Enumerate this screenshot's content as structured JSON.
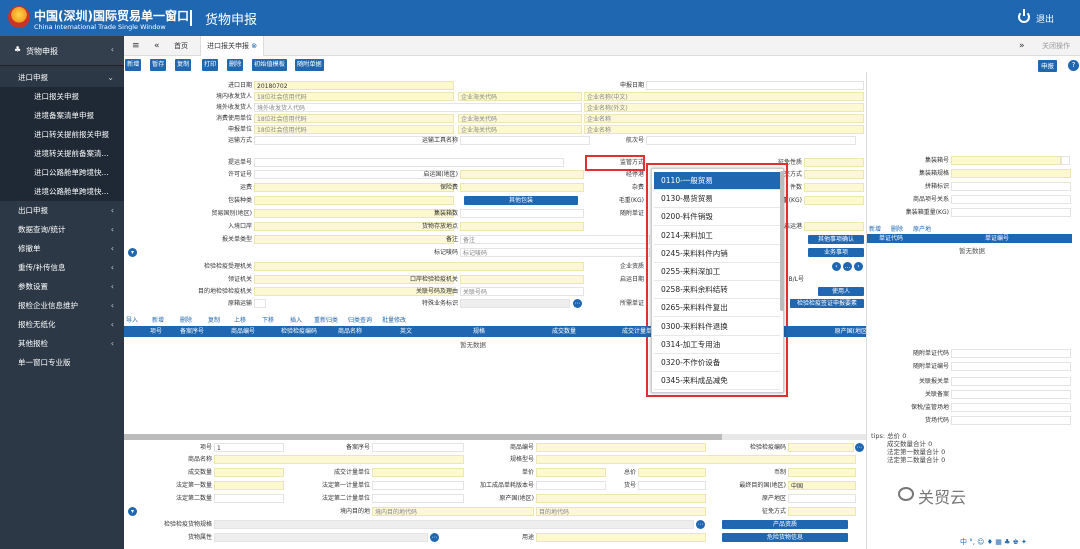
{
  "header": {
    "brand_cn": "中国(深圳)国际贸易单一窗口",
    "brand_en": "China International Trade Single Window",
    "page_title": "货物申报",
    "logout": "退出"
  },
  "sidebar": {
    "head": "货物申报",
    "items": [
      {
        "label": "进口申报",
        "sub": false
      },
      {
        "label": "进口报关申报",
        "sub": true
      },
      {
        "label": "进境备案清单申报",
        "sub": true
      },
      {
        "label": "进口转关提前报关申报",
        "sub": true
      },
      {
        "label": "进境转关提前备案清...",
        "sub": true
      },
      {
        "label": "进口公路舱单跨境快...",
        "sub": true
      },
      {
        "label": "进境公路舱单跨境快...",
        "sub": true
      },
      {
        "label": "出口申报",
        "sub": false
      },
      {
        "label": "数据查询/统计",
        "sub": false
      },
      {
        "label": "修撤单",
        "sub": false
      },
      {
        "label": "重传/补传信息",
        "sub": false
      },
      {
        "label": "参数设置",
        "sub": false
      },
      {
        "label": "报检企业信息维护",
        "sub": false
      },
      {
        "label": "报检无纸化",
        "sub": false
      },
      {
        "label": "其他报检",
        "sub": false
      },
      {
        "label": "单一窗口专业版",
        "sub": false
      }
    ]
  },
  "tabs": {
    "home": "首页",
    "active": "进口报关申报",
    "close_ops": "关闭操作"
  },
  "toolbar": [
    "新增",
    "暂存",
    "复制",
    "打印",
    "删除",
    "初始值模板",
    "随附单据"
  ],
  "declare_button": "申报",
  "form": {
    "import_date": "20180702",
    "import_date_label": "进口日期",
    "declare_date_label": "申报日期",
    "consignee_label": "境内收发货人",
    "consignee_ph": "18位社会信用代码",
    "company_code_ph": "企业海关代码",
    "company_name_ph": "企业名称(中文)",
    "overseas_label": "境外收发货人",
    "overseas_ph": "境外收发货人代码",
    "company_name_en_ph": "企业名称(外文)",
    "consumer_label": "消费使用单位",
    "declarant_label": "申报单位",
    "company_name_ph2": "企业名称",
    "transport_label": "运输方式",
    "vehicle_label": "运输工具名称",
    "voyage_label": "航次号",
    "bill_label": "提运单号",
    "supervision_label": "监管方式",
    "nature_label": "征免性质",
    "license_label": "许可证号",
    "origin_country_label": "启运国(地区)",
    "port_label": "经停港",
    "trade_terms_label": "成交方式",
    "freight_label": "运费",
    "insurance_label": "保险费",
    "misc_label": "杂费",
    "pieces_label": "件数",
    "packaging_label": "包装种类",
    "other_packaging": "其他包装",
    "gross_label": "毛重(KG)",
    "net_label": "净重(KG)",
    "trade_country_label": "贸易国别(地区)",
    "container_count_label": "集装箱数",
    "attached_label": "随附单证",
    "entry_port_label": "入境口岸",
    "goods_place_label": "货物存放地点",
    "dest_port_label": "启运港",
    "declare_type_label": "报关单类型",
    "remarks_label": "备注",
    "remarks_ph": "备注",
    "mark_label": "标记唛码",
    "mark_ph": "标记唛码",
    "other_matters": "其他事项确认",
    "business_matters": "业务事项",
    "inspection_auth_label": "检验检疫受理机关",
    "enterprise_qual_label": "企业资质",
    "receiving_auth_label": "领证机关",
    "port_auth_label": "口岸检验检疫机关",
    "arrival_date_label": "启运日期",
    "bl_label": "B/L号",
    "dest_auth_label": "目的地检验检疫机关",
    "related_no_label": "关联号码及理由",
    "related_no_ph": "关联号码",
    "user": "使用人",
    "original_label": "原箱运输",
    "special_label": "特殊业务标识",
    "required_label": "所需单证",
    "inspection_cert": "检验检疫签证申报要素"
  },
  "grid": {
    "toolbar": [
      "导入",
      "新增",
      "删除",
      "复制",
      "上移",
      "下移",
      "插入",
      "重新归类",
      "归类查询",
      "批量修改"
    ],
    "columns": [
      "项号",
      "备案序号",
      "商品编号",
      "检验检疫编码",
      "商品名称",
      "英文",
      "规格",
      "成交数量",
      "成交计量单位",
      "原产国(地区)"
    ],
    "empty": "暂无数据"
  },
  "lower": {
    "item_no": "项号",
    "item_no_value": "1",
    "record_no": "备案序号",
    "goods_code": "商品编号",
    "insp_code": "检验检疫编码",
    "goods_name": "商品名称",
    "spec": "规格型号",
    "trade_qty": "成交数量",
    "trade_unit": "成交计量单位",
    "unit_price": "单价",
    "total_price": "总价",
    "currency": "币制",
    "legal_qty1": "法定第一数量",
    "legal_unit1": "法定第一计量单位",
    "version_no": "加工成品单耗版本号",
    "goods_no": "货号",
    "final_dest": "最终目的国(地区)",
    "final_dest_value": "中国",
    "legal_qty2": "法定第二数量",
    "legal_unit2": "法定第二计量单位",
    "origin": "原产国(地区)",
    "origin_area": "原产地区",
    "dest_domestic": "境内目的地",
    "dest_domestic_ph": "境内目的地代码",
    "dest_code_ph": "目的地代码",
    "exemption": "征免方式",
    "insp_spec": "检验检疫货物规格",
    "product_qual": "产品资质",
    "goods_attr": "货物属性",
    "usage": "用途",
    "dangerous": "危险货物信息"
  },
  "right_panel": {
    "container_no": "集装箱号",
    "container_spec": "集装箱规格",
    "pin_mark": "拼箱标识",
    "goods_relation": "商品项号关系",
    "container_weight": "集装箱重量(KG)",
    "toolbar": [
      "新增",
      "删除",
      "原产地"
    ],
    "col_code": "单证代码",
    "col_no": "单证编号",
    "empty": "暂无数据",
    "attached_code": "随附单证代码",
    "attached_no": "随附单证编号",
    "related_decl": "关联报关单",
    "related_record": "关联备案",
    "bonded_place": "保税/监管场地",
    "yard_code": "货场代码",
    "tips_title": "tips: 总价 0",
    "tips": [
      "成交数量合计 0",
      "法定第一数量合计 0",
      "法定第二数量合计 0"
    ]
  },
  "dropdown": {
    "items": [
      "0110-一般贸易",
      "0130-易货贸易",
      "0200-料件销毁",
      "0214-来料加工",
      "0245-来料料件内销",
      "0255-来料深加工",
      "0258-来料余料结转",
      "0265-来料料件复出",
      "0300-来料料件退换",
      "0314-加工专用油",
      "0320-不作价设备",
      "0345-来料成品减免"
    ],
    "selected_index": 0
  },
  "watermark": "关贸云",
  "tray": "中 °, ☺ ♦ ▦ ♣ ♚ ✦"
}
